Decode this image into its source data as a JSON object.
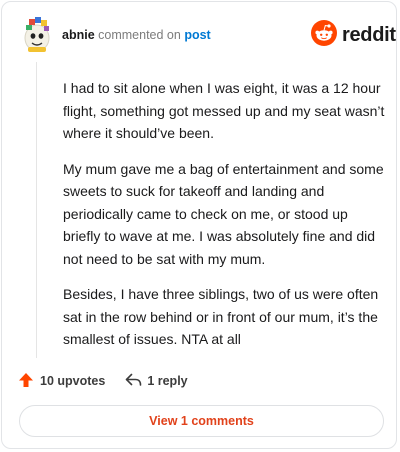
{
  "header": {
    "username": "abnie",
    "verb": "commented on",
    "post_link": "post",
    "brand": "reddit"
  },
  "comment": {
    "paragraphs": [
      "I had to sit alone when I was eight, it was a 12 hour flight, something got messed up and my seat wasn’t where it should’ve been.",
      "My mum gave me a bag of entertainment and some sweets to suck for takeoff and landing and periodically came to check on me, or stood up briefly to wave at me. I was absolutely fine and did not need to be sat with my mum.",
      "Besides, I have three siblings, two of us were often sat in the row behind or in front of our mum, it’s the smallest of issues. NTA at all"
    ]
  },
  "actions": {
    "upvotes": "10 upvotes",
    "replies": "1 reply"
  },
  "footer": {
    "view_comments": "View 1 comments"
  },
  "colors": {
    "accent": "#ff4500",
    "link": "#0079d3",
    "view_button_text": "#e1421b"
  },
  "icons": [
    "avatar",
    "reddit-logo-icon",
    "upvote-arrow-icon",
    "reply-arrow-icon"
  ]
}
